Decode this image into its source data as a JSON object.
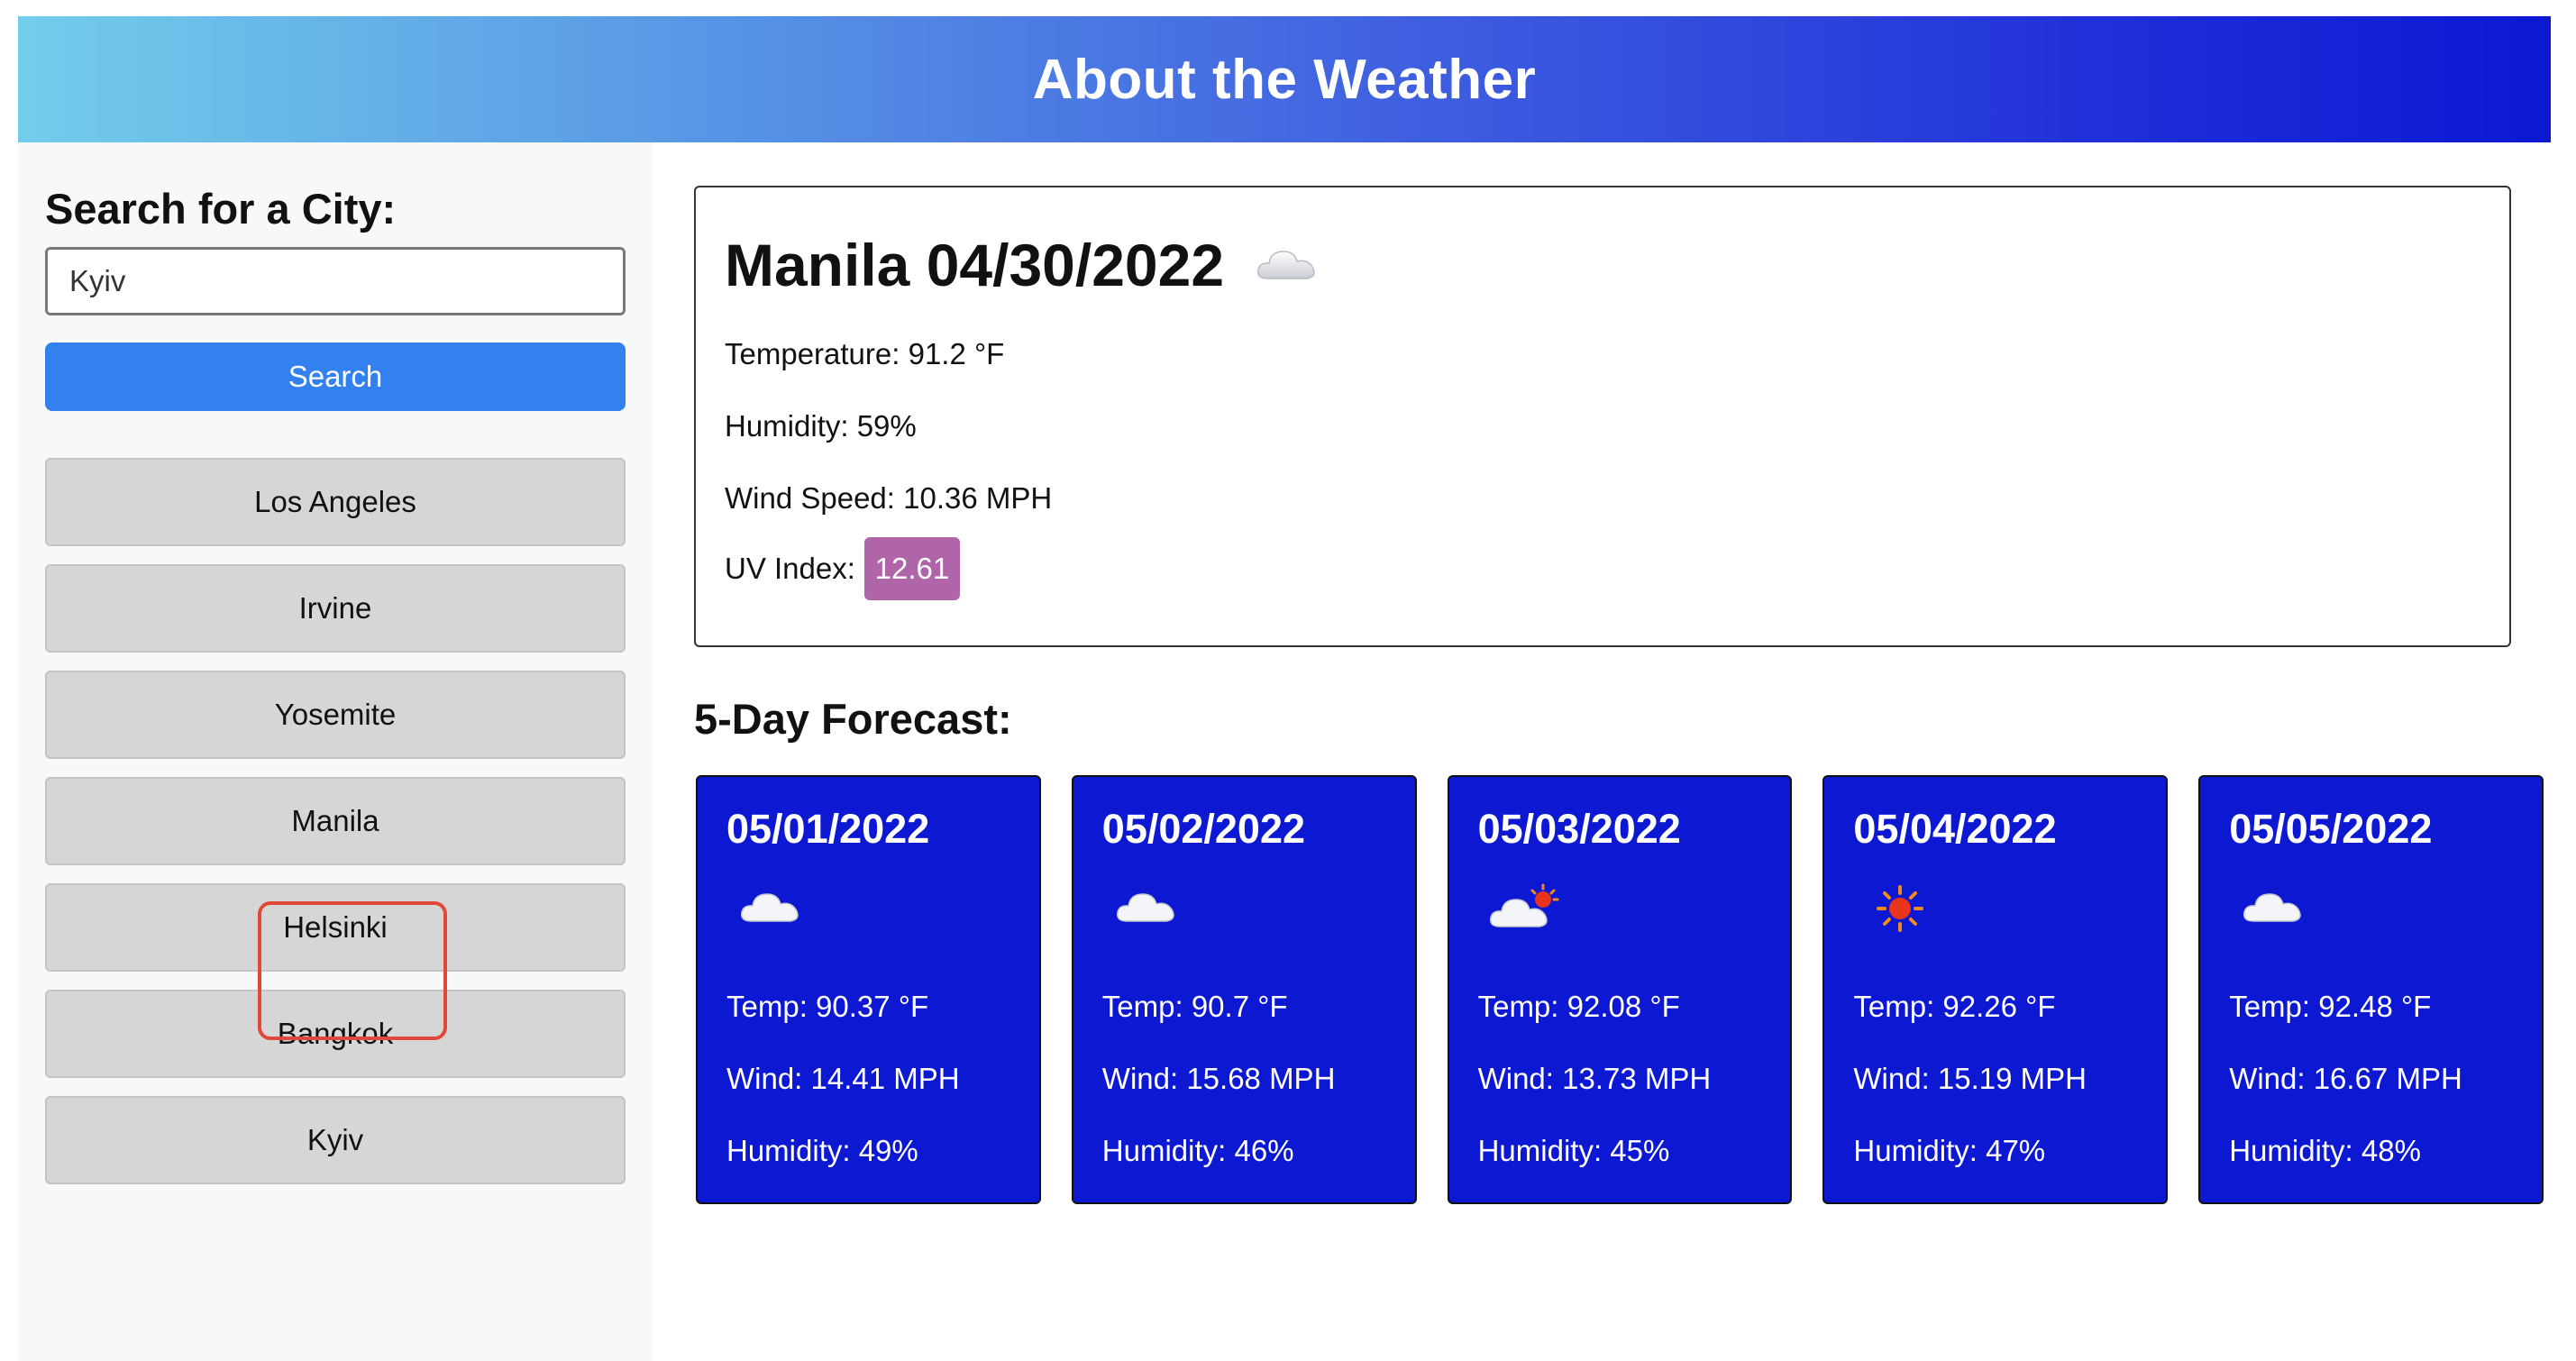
{
  "header": {
    "title": "About the Weather"
  },
  "sidebar": {
    "title": "Search for a City:",
    "search_value": "Kyiv",
    "search_button": "Search",
    "history": [
      "Los Angeles",
      "Irvine",
      "Yosemite",
      "Manila",
      "Helsinki",
      "Bangkok",
      "Kyiv"
    ]
  },
  "current": {
    "city_date": "Manila 04/30/2022",
    "icon": "cloud-icon",
    "temperature": "Temperature: 91.2 °F",
    "humidity": "Humidity: 59%",
    "wind": "Wind Speed: 10.36 MPH",
    "uv_label": "UV Index:",
    "uv_value": "12.61",
    "uv_color": "#b065a8"
  },
  "forecast": {
    "title": "5-Day Forecast:",
    "card_color": "#0c18d2",
    "days": [
      {
        "date": "05/01/2022",
        "icon": "cloud-icon",
        "temp": "Temp: 90.37 °F",
        "wind": "Wind: 14.41 MPH",
        "humidity": "Humidity: 49%"
      },
      {
        "date": "05/02/2022",
        "icon": "cloud-icon",
        "temp": "Temp: 90.7 °F",
        "wind": "Wind: 15.68 MPH",
        "humidity": "Humidity: 46%"
      },
      {
        "date": "05/03/2022",
        "icon": "partly-cloudy-icon",
        "temp": "Temp: 92.08 °F",
        "wind": "Wind: 13.73 MPH",
        "humidity": "Humidity: 45%"
      },
      {
        "date": "05/04/2022",
        "icon": "sun-icon",
        "temp": "Temp: 92.26 °F",
        "wind": "Wind: 15.19 MPH",
        "humidity": "Humidity: 47%"
      },
      {
        "date": "05/05/2022",
        "icon": "cloud-icon",
        "temp": "Temp: 92.48 °F",
        "wind": "Wind: 16.67 MPH",
        "humidity": "Humidity: 48%"
      }
    ]
  }
}
